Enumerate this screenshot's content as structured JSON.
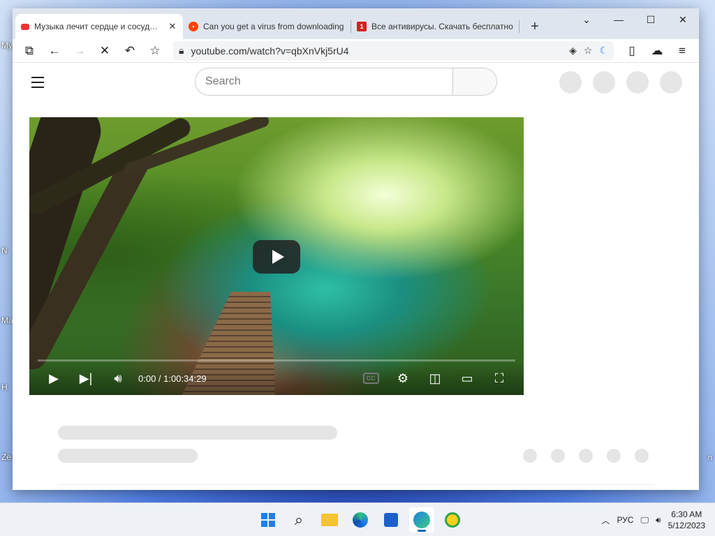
{
  "desktop": {
    "icon_labels": [
      "My",
      "N",
      "Ma",
      "H",
      "Ze"
    ],
    "right_label": "n"
  },
  "browser": {
    "tabs": [
      {
        "title": "Музыка лечит сердце и сосуды🌿",
        "favicon": "youtube-icon",
        "active": true
      },
      {
        "title": "Can you get a virus from downloading",
        "favicon": "reddit-icon",
        "active": false
      },
      {
        "title": "Все антивирусы. Скачать бесплатно",
        "favicon": "antivirus-site-icon",
        "active": false
      }
    ],
    "new_tab_symbol": "+",
    "address": "youtube.com/watch?v=qbXnVkj5rU4"
  },
  "youtube": {
    "search_placeholder": "Search",
    "player": {
      "time": "0:00 / 1:00:34:29",
      "cc_label": "CC",
      "progress": 0
    }
  },
  "taskbar": {
    "language": "РУС",
    "time": "6:30 AM",
    "date": "5/12/2023"
  },
  "colors": {
    "accent": "#0067c0",
    "youtube_red": "#e33333"
  }
}
